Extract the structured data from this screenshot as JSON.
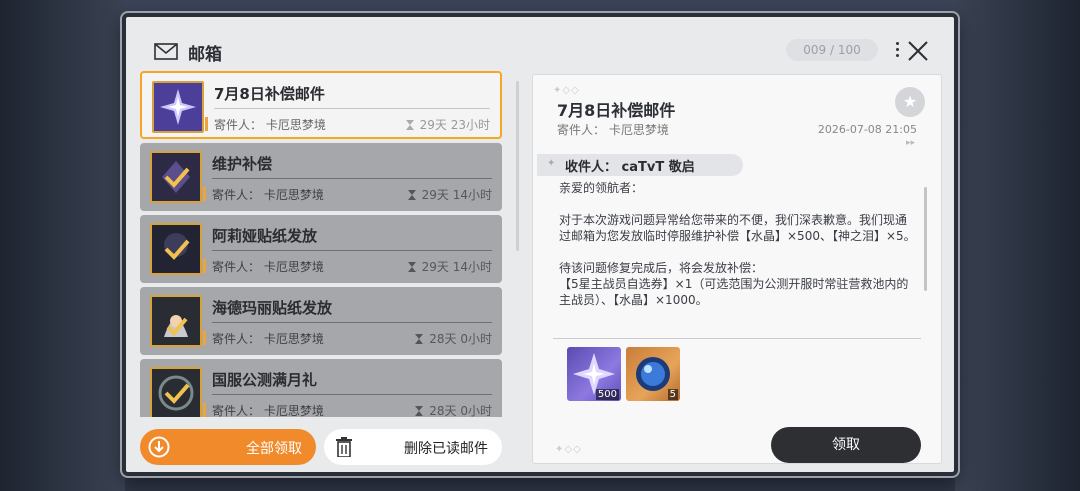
{
  "window": {
    "title": "邮箱",
    "counter": "009 / 100"
  },
  "mail_list": [
    {
      "subject": "7月8日补偿邮件",
      "sender": "寄件人：  卡厄思梦境",
      "time_left": "29天 23小时",
      "selected": true
    },
    {
      "subject": "维护补偿",
      "sender": "寄件人：  卡厄思梦境",
      "time_left": "29天 14小时",
      "selected": false
    },
    {
      "subject": "阿莉娅贴纸发放",
      "sender": "寄件人：  卡厄思梦境",
      "time_left": "29天 14小时",
      "selected": false
    },
    {
      "subject": "海德玛丽贴纸发放",
      "sender": "寄件人：  卡厄思梦境",
      "time_left": "28天 0小时",
      "selected": false
    },
    {
      "subject": "国服公测满月礼",
      "sender": "寄件人：  卡厄思梦境",
      "time_left": "28天 0小时",
      "selected": false
    }
  ],
  "buttons": {
    "claim_all": "全部领取",
    "delete_read": "删除已读邮件",
    "claim": "领取"
  },
  "detail": {
    "subject": "7月8日补偿邮件",
    "sender": "寄件人：  卡厄思梦境",
    "date": "2026-07-08 21:05",
    "recipient": "收件人：  caTvT 敬启",
    "greeting": "亲爱的领航者：",
    "paragraph1": "对于本次游戏问题异常给您带来的不便，我们深表歉意。我们现通过邮箱为您发放临时停服维护补偿【水晶】×500、【神之泪】×5。",
    "paragraph2": "待该问题修复完成后，将会发放补偿：\n【5星主战员自选券】×1（可选范围为公测开服时常驻营救池内的主战员）、【水晶】×1000。",
    "attachments": [
      {
        "name": "crystal",
        "qty": "500"
      },
      {
        "name": "tear-of-god",
        "qty": "5"
      }
    ]
  },
  "colors": {
    "accent_orange": "#f08a2a",
    "selected_border": "#f5a623",
    "dark_button": "#2d2f33"
  }
}
